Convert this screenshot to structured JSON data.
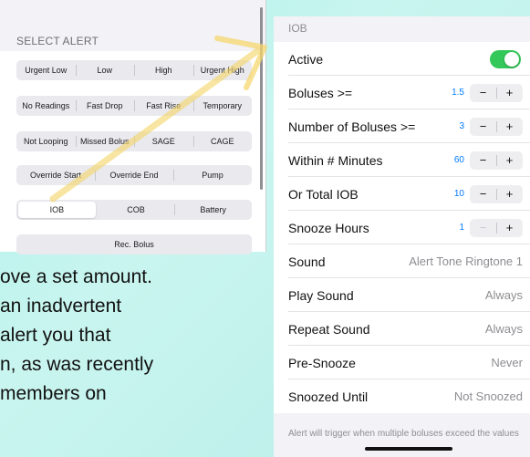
{
  "left_panel": {
    "section_header": "SELECT ALERT",
    "segment_rows": [
      {
        "items": [
          "Urgent Low",
          "Low",
          "High",
          "Urgent High"
        ],
        "selected": -1
      },
      {
        "items": [
          "No Readings",
          "Fast Drop",
          "Fast Rise",
          "Temporary"
        ],
        "selected": -1
      },
      {
        "items": [
          "Not Looping",
          "Missed Bolus",
          "SAGE",
          "CAGE"
        ],
        "selected": -1
      },
      {
        "items": [
          "Override Start",
          "Override End",
          "Pump"
        ],
        "selected": -1
      },
      {
        "items": [
          "IOB",
          "COB",
          "Battery"
        ],
        "selected": 0
      },
      {
        "items": [
          "Rec. Bolus"
        ],
        "selected": -1
      }
    ]
  },
  "blog_text": {
    "lines": [
      "ove a set amount.",
      "an inadvertent",
      "alert you that",
      "n, as was recently",
      "members on"
    ]
  },
  "right_panel": {
    "section_header": "IOB",
    "rows": {
      "active": {
        "label": "Active",
        "on": true
      },
      "boluses": {
        "label": "Boluses >=",
        "value": "1.5"
      },
      "number_boluses": {
        "label": "Number of Boluses >=",
        "value": "3"
      },
      "within_minutes": {
        "label": "Within # Minutes",
        "value": "60"
      },
      "total_iob": {
        "label": "Or Total IOB",
        "value": "10"
      },
      "snooze_hours": {
        "label": "Snooze Hours",
        "value": "1"
      },
      "sound": {
        "label": "Sound",
        "value": "Alert Tone Ringtone 1"
      },
      "play_sound": {
        "label": "Play Sound",
        "value": "Always"
      },
      "repeat_sound": {
        "label": "Repeat Sound",
        "value": "Always"
      },
      "pre_snooze": {
        "label": "Pre-Snooze",
        "value": "Never"
      },
      "snoozed_until": {
        "label": "Snoozed Until",
        "value": "Not Snoozed"
      }
    },
    "stepper": {
      "minus": "−",
      "plus": "+"
    },
    "footer_note": "Alert will trigger when multiple boluses exceed the values"
  },
  "colors": {
    "accent": "#007aff",
    "toggle_on": "#34c759",
    "arrow": "#f5d76e"
  }
}
